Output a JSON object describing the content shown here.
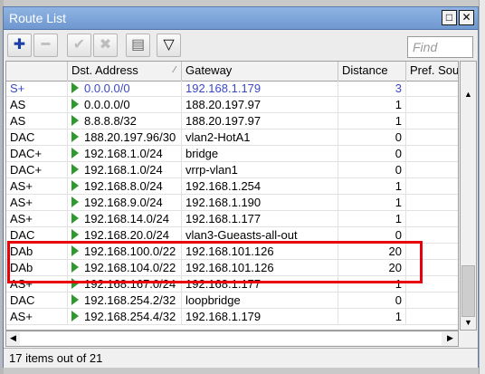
{
  "window": {
    "title": "Route List",
    "restore_glyph": "□",
    "close_glyph": "✕"
  },
  "toolbar": {
    "add_icon": "plus-icon",
    "add_glyph": "✚",
    "remove_icon": "minus-icon",
    "remove_glyph": "━",
    "enable_icon": "check-icon",
    "enable_glyph": "✔",
    "disable_icon": "x-icon",
    "disable_glyph": "✖",
    "comment_icon": "note-icon",
    "comment_glyph": "▤",
    "filter_icon": "filter-icon",
    "filter_glyph": "▽",
    "find_placeholder": "Find"
  },
  "table": {
    "columns": [
      "",
      "Dst. Address",
      "Gateway",
      "Distance",
      "Pref. Sou"
    ],
    "rows": [
      {
        "flags": "S+",
        "dst": "0.0.0.0/0",
        "gateway": "192.168.1.179",
        "distance": "3",
        "blue": true
      },
      {
        "flags": "AS",
        "dst": "0.0.0.0/0",
        "gateway": "188.20.197.97",
        "distance": "1",
        "blue": false
      },
      {
        "flags": "AS",
        "dst": "8.8.8.8/32",
        "gateway": "188.20.197.97",
        "distance": "1",
        "blue": false
      },
      {
        "flags": "DAC",
        "dst": "188.20.197.96/30",
        "gateway": "vlan2-HotA1",
        "distance": "0",
        "blue": false
      },
      {
        "flags": "DAC+",
        "dst": "192.168.1.0/24",
        "gateway": "bridge",
        "distance": "0",
        "blue": false
      },
      {
        "flags": "DAC+",
        "dst": "192.168.1.0/24",
        "gateway": "vrrp-vlan1",
        "distance": "0",
        "blue": false
      },
      {
        "flags": "AS+",
        "dst": "192.168.8.0/24",
        "gateway": "192.168.1.254",
        "distance": "1",
        "blue": false
      },
      {
        "flags": "AS+",
        "dst": "192.168.9.0/24",
        "gateway": "192.168.1.190",
        "distance": "1",
        "blue": false
      },
      {
        "flags": "AS+",
        "dst": "192.168.14.0/24",
        "gateway": "192.168.1.177",
        "distance": "1",
        "blue": false
      },
      {
        "flags": "DAC",
        "dst": "192.168.20.0/24",
        "gateway": "vlan3-Gueasts-all-out",
        "distance": "0",
        "blue": false
      },
      {
        "flags": "DAb",
        "dst": "192.168.100.0/22",
        "gateway": "192.168.101.126",
        "distance": "20",
        "blue": false
      },
      {
        "flags": "DAb",
        "dst": "192.168.104.0/22",
        "gateway": "192.168.101.126",
        "distance": "20",
        "blue": false
      },
      {
        "flags": "AS+",
        "dst": "192.168.167.0/24",
        "gateway": "192.168.1.177",
        "distance": "1",
        "blue": false
      },
      {
        "flags": "DAC",
        "dst": "192.168.254.2/32",
        "gateway": "loopbridge",
        "distance": "0",
        "blue": false
      },
      {
        "flags": "AS+",
        "dst": "192.168.254.4/32",
        "gateway": "192.168.1.179",
        "distance": "1",
        "blue": false
      }
    ]
  },
  "status": {
    "text": "17 items out of 21"
  },
  "colors": {
    "accent": "#6f98d0",
    "highlight": "#e8000b",
    "active_route": "#3a48c8",
    "route_arrow": "#2e9a2e"
  }
}
